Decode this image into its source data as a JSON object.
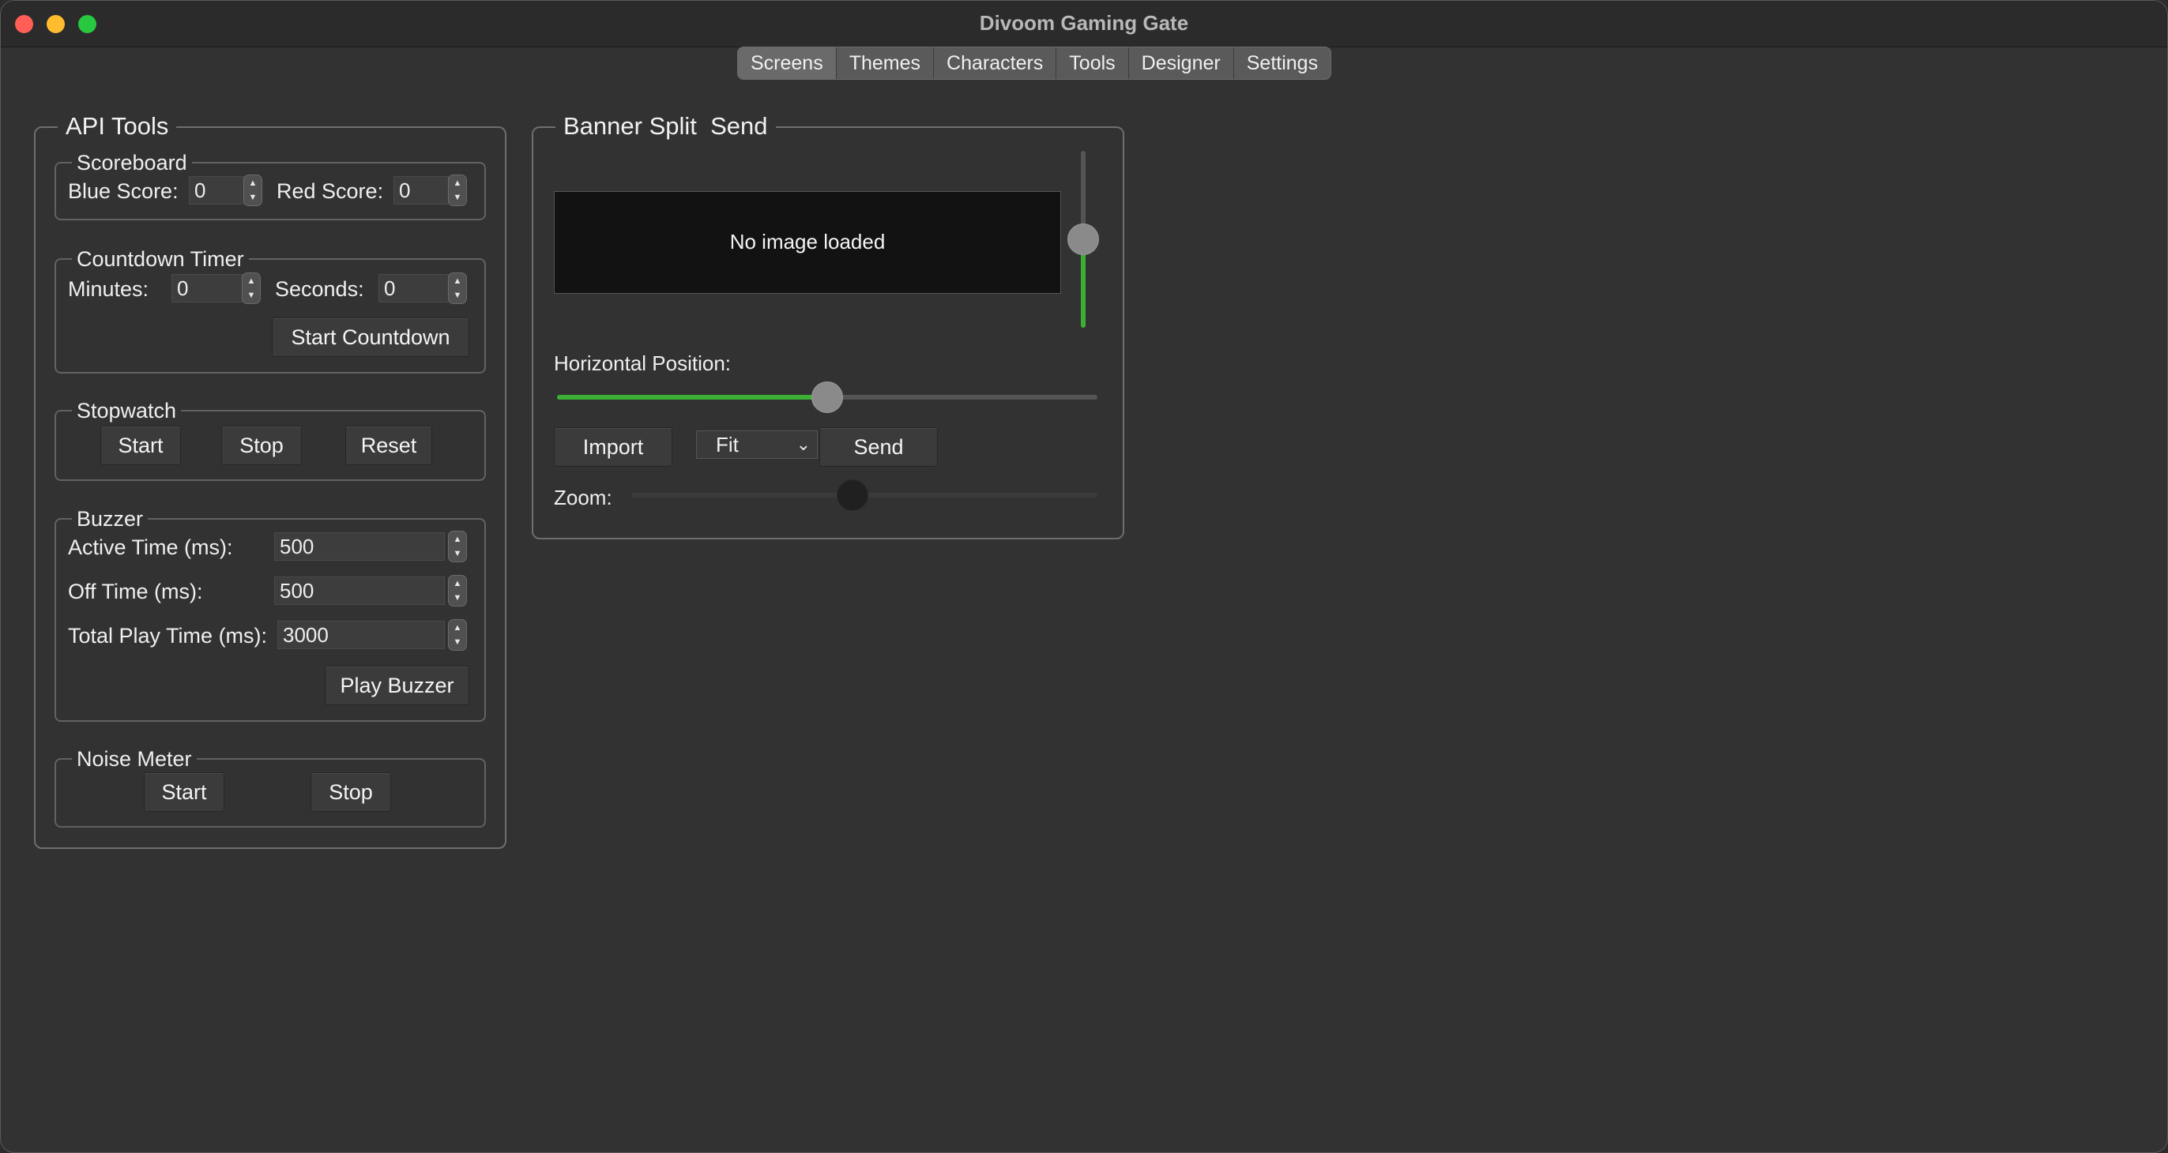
{
  "window": {
    "title": "Divoom Gaming Gate"
  },
  "tabs": [
    "Screens",
    "Themes",
    "Characters",
    "Tools",
    "Designer",
    "Settings"
  ],
  "api_tools": {
    "title": "API Tools",
    "scoreboard": {
      "title": "Scoreboard",
      "blue_label": "Blue Score:",
      "blue_value": "0",
      "red_label": "Red Score:",
      "red_value": "0"
    },
    "countdown": {
      "title": "Countdown Timer",
      "minutes_label": "Minutes:",
      "minutes_value": "0",
      "seconds_label": "Seconds:",
      "seconds_value": "0",
      "start_label": "Start Countdown"
    },
    "stopwatch": {
      "title": "Stopwatch",
      "start_label": "Start",
      "stop_label": "Stop",
      "reset_label": "Reset"
    },
    "buzzer": {
      "title": "Buzzer",
      "active_label": "Active Time (ms):",
      "active_value": "500",
      "off_label": "Off Time (ms):",
      "off_value": "500",
      "total_label": "Total Play Time (ms):",
      "total_value": "3000",
      "play_label": "Play Buzzer"
    },
    "noise": {
      "title": "Noise Meter",
      "start_label": "Start",
      "stop_label": "Stop"
    }
  },
  "banner": {
    "title": "Banner Split  Send",
    "preview_text": "No image loaded",
    "vertical_position": 0.5,
    "horizontal_label": "Horizontal Position:",
    "horizontal_position": 0.5,
    "import_label": "Import",
    "fit_value": "Fit",
    "send_label": "Send",
    "zoom_label": "Zoom:",
    "zoom_value": 0.48
  },
  "colors": {
    "accent": "#3cb034",
    "background": "#323232"
  }
}
